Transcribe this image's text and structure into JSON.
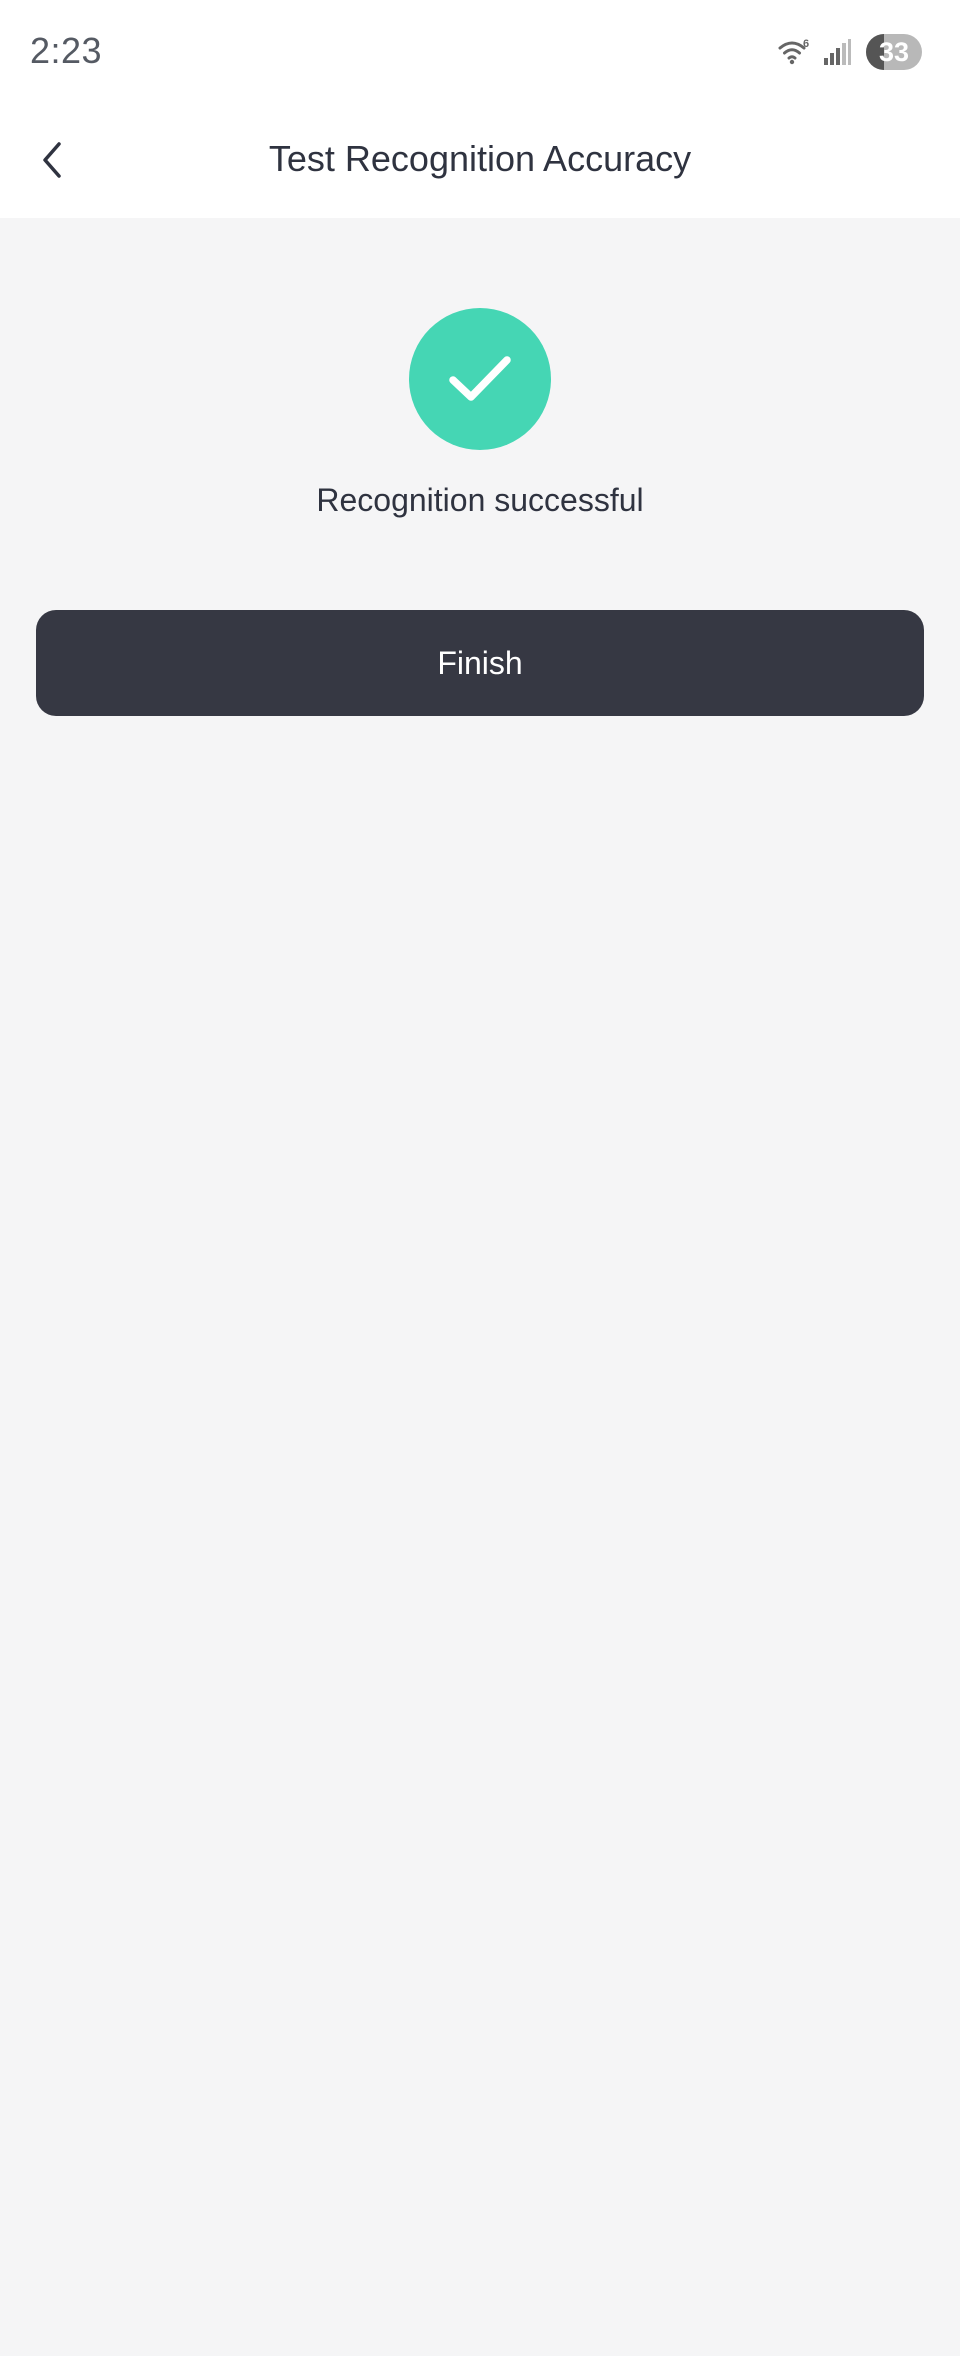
{
  "status_bar": {
    "time": "2:23",
    "wifi_badge": "6",
    "battery_level": "33",
    "battery_fraction": 0.33
  },
  "nav": {
    "title": "Test Recognition Accuracy",
    "back_icon": "chevron-left-icon"
  },
  "result": {
    "icon": "checkmark-icon",
    "icon_color": "#45d6b4",
    "message": "Recognition successful"
  },
  "actions": {
    "finish_label": "Finish",
    "finish_color": "#363843"
  }
}
